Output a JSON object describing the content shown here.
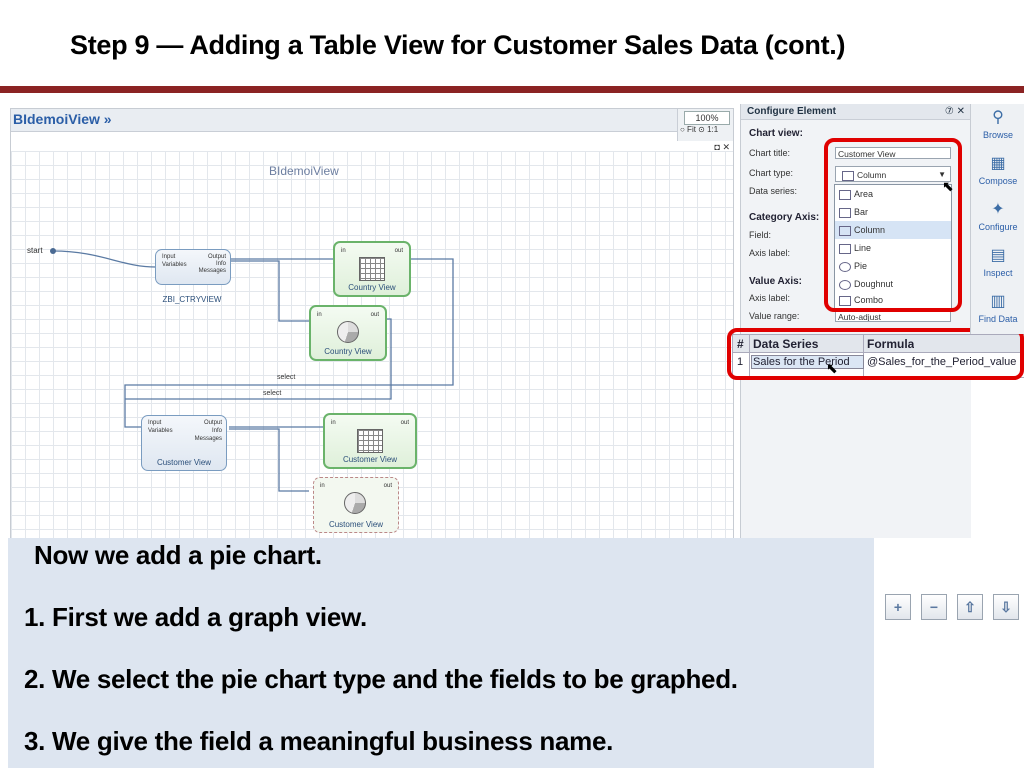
{
  "slide": {
    "title": "Step 9 — Adding a Table View for Customer Sales Data (cont.)"
  },
  "canvas": {
    "tab_label": "BIdemoiView »",
    "zoom": "100%",
    "fit_label": "○ Fit ⊙ 1:1",
    "window_icons": "◘ ✕",
    "diagram_label": "BIdemoiView",
    "start_label": "start",
    "select_label_1": "select",
    "select_label_2": "select",
    "nodes": {
      "ctry_query": {
        "caption": "ZBI_CTRYVIEW",
        "in_ports": [
          "Input",
          "Variables"
        ],
        "out_ports": [
          "Output",
          "Info",
          "Messages"
        ]
      },
      "country_table": {
        "caption": "Country View",
        "in": "in",
        "out": "out"
      },
      "country_pie": {
        "caption": "Country View",
        "in": "in",
        "out": "out"
      },
      "cust_query": {
        "caption": "Customer View",
        "in_ports": [
          "Input",
          "Variables"
        ],
        "out_ports": [
          "Output",
          "Info",
          "Messages"
        ]
      },
      "customer_table": {
        "caption": "Customer View",
        "in": "in",
        "out": "out"
      },
      "customer_pie": {
        "caption": "Customer View",
        "in": "in",
        "out": "out"
      }
    }
  },
  "config": {
    "header": "Configure Element",
    "header_icons": "⑦ ✕",
    "chart_view_label": "Chart view:",
    "chart_title_label": "Chart title:",
    "chart_title_value": "Customer View",
    "chart_type_label": "Chart type:",
    "chart_type_value": "Column",
    "data_series_label": "Data series:",
    "category_axis_label": "Category Axis:",
    "field_label": "Field:",
    "axis_label_label": "Axis label:",
    "value_axis_label": "Value Axis:",
    "axis_label_label_2": "Axis label:",
    "value_range_label": "Value range:",
    "value_range_value": "Auto-adjust",
    "dropdown_options": [
      "Area",
      "Bar",
      "Column",
      "Line",
      "Pie",
      "Doughnut",
      "Combo"
    ],
    "dropdown_selected": "Column"
  },
  "data_series_table": {
    "headers": [
      "#",
      "Data Series",
      "Formula"
    ],
    "rows": [
      {
        "num": "1",
        "series": "Sales for the Period",
        "formula": "@Sales_for_the_Period_value"
      }
    ]
  },
  "toolbar": {
    "items": [
      {
        "label": "Browse",
        "icon": "binoculars-icon"
      },
      {
        "label": "Compose",
        "icon": "compose-icon"
      },
      {
        "label": "Configure",
        "icon": "puzzle-icon"
      },
      {
        "label": "Inspect",
        "icon": "inspect-icon"
      },
      {
        "label": "Find Data",
        "icon": "database-icon"
      }
    ]
  },
  "bottom_tools": {
    "add": "+",
    "remove": "−",
    "up": "⇧",
    "down": "⇩"
  },
  "callout": {
    "line1": "Now we add a pie chart.",
    "line2": "1.  First we add a graph view.",
    "line3": "2.  We select the pie chart type and the fields to be graphed.",
    "line4": "3. We give the field a meaningful business name."
  },
  "colors": {
    "title_rule": "#8b2323",
    "highlight": "#e00000",
    "callout_bg": "#dde5f0"
  }
}
